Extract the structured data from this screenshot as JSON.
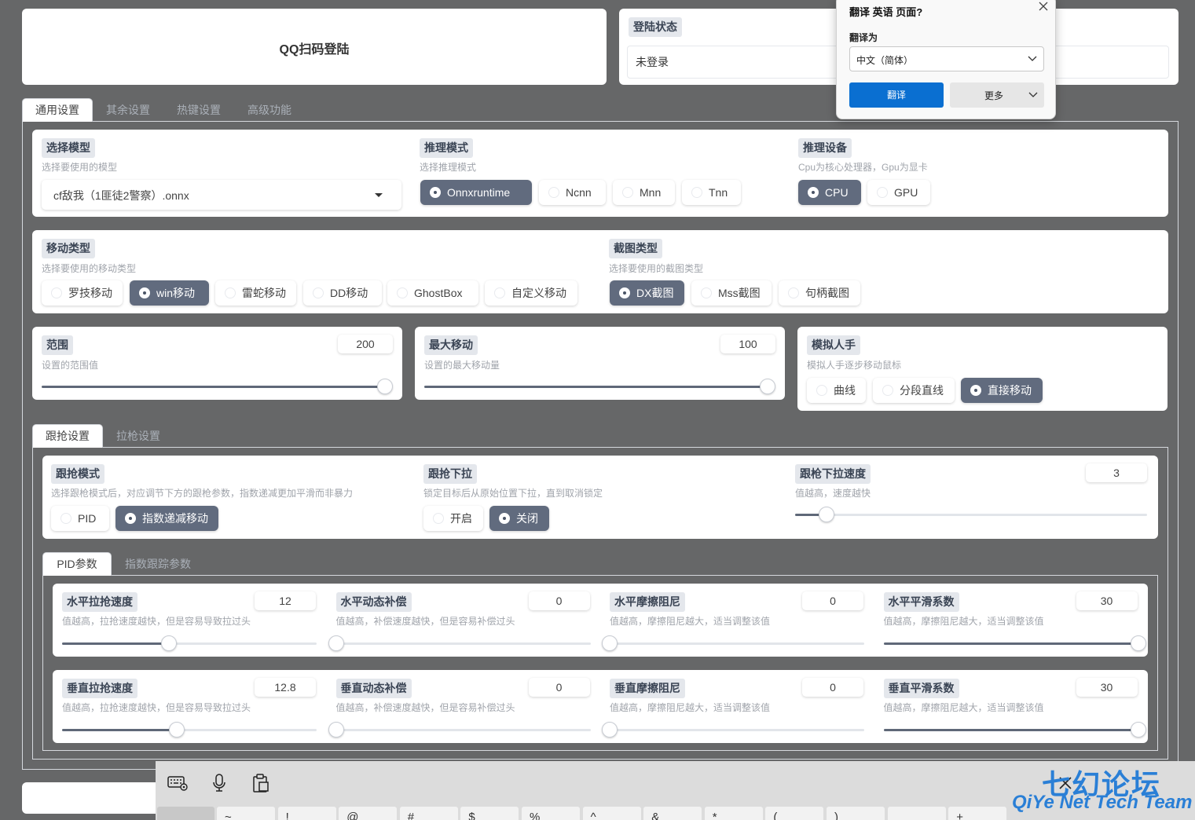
{
  "login": {
    "qr_label": "QQ扫码登陆",
    "status_label": "登陆状态",
    "status_value": "未登录"
  },
  "main_tabs": [
    "通用设置",
    "其余设置",
    "热键设置",
    "高级功能"
  ],
  "model": {
    "label": "选择模型",
    "desc": "选择要使用的模型",
    "value": "cf敌我（1匪徒2警察）.onnx"
  },
  "infer_mode": {
    "label": "推理模式",
    "desc": "选择推理模式",
    "options": [
      "Onnxruntime",
      "Ncnn",
      "Mnn",
      "Tnn"
    ],
    "selected": "Onnxruntime"
  },
  "infer_device": {
    "label": "推理设备",
    "desc": "Cpu为核心处理器，Gpu为显卡",
    "options": [
      "CPU",
      "GPU"
    ],
    "selected": "CPU"
  },
  "move_type": {
    "label": "移动类型",
    "desc": "选择要使用的移动类型",
    "options": [
      "罗技移动",
      "win移动",
      "雷蛇移动",
      "DD移动",
      "GhostBox",
      "自定义移动"
    ],
    "selected": "win移动"
  },
  "capture_type": {
    "label": "截图类型",
    "desc": "选择要使用的截图类型",
    "options": [
      "DX截图",
      "Mss截图",
      "句柄截图"
    ],
    "selected": "DX截图"
  },
  "range": {
    "label": "范围",
    "desc": "设置的范围值",
    "value": "200",
    "fraction": 1.0
  },
  "max_move": {
    "label": "最大移动",
    "desc": "设置的最大移动量",
    "value": "100",
    "fraction": 1.0
  },
  "human": {
    "label": "模拟人手",
    "desc": "模拟人手逐步移动鼠标",
    "options": [
      "曲线",
      "分段直线",
      "直接移动"
    ],
    "selected": "直接移动"
  },
  "sub_tabs": [
    "跟抢设置",
    "拉枪设置"
  ],
  "follow_mode": {
    "label": "跟抢模式",
    "desc": "选择跟枪模式后，对应调节下方的跟枪参数，指数递减更加平滑而非暴力",
    "options": [
      "PID",
      "指数递减移动"
    ],
    "selected": "指数递减移动"
  },
  "follow_pull": {
    "label": "跟抢下拉",
    "desc": "锁定目标后从原始位置下拉，直到取消锁定",
    "options": [
      "开启",
      "关闭"
    ],
    "selected": "关闭"
  },
  "pull_speed": {
    "label": "跟枪下拉速度",
    "desc": "值越高，速度越快",
    "value": "3",
    "fraction": 0.09
  },
  "param_tabs": [
    "PID参数",
    "指数跟踪参数"
  ],
  "pid": {
    "row1": [
      {
        "label": "水平拉抢速度",
        "desc": "值越高，拉抢速度越快，但是容易导致拉过头",
        "value": "12",
        "fraction": 0.42
      },
      {
        "label": "水平动态补偿",
        "desc": "值越高，补偿速度越快，但是容易补偿过头",
        "value": "0",
        "fraction": 0.0
      },
      {
        "label": "水平摩擦阻尼",
        "desc": "值越高，摩擦阻尼越大，适当调整该值",
        "value": "0",
        "fraction": 0.0
      },
      {
        "label": "水平平滑系数",
        "desc": "值越高，摩擦阻尼越大，适当调整该值",
        "value": "30",
        "fraction": 1.0
      }
    ],
    "row2": [
      {
        "label": "垂直拉抢速度",
        "desc": "值越高，拉抢速度越快，但是容易导致拉过头",
        "value": "12.8",
        "fraction": 0.45
      },
      {
        "label": "垂直动态补偿",
        "desc": "值越高，补偿速度越快，但是容易补偿过头",
        "value": "0",
        "fraction": 0.0
      },
      {
        "label": "垂直摩擦阻尼",
        "desc": "值越高，摩擦阻尼越大，适当调整该值",
        "value": "0",
        "fraction": 0.0
      },
      {
        "label": "垂直平滑系数",
        "desc": "值越高，摩擦阻尼越大，适当调整该值",
        "value": "30",
        "fraction": 1.0
      }
    ]
  },
  "translate_popup": {
    "title": "翻译 英语 页面?",
    "to_label": "翻译为",
    "language": "中文（简体）",
    "translate_btn": "翻译",
    "more_btn": "更多"
  },
  "keyboard": {
    "keys": [
      "~",
      "!",
      "@",
      "#",
      "$",
      "%",
      "^",
      "&",
      "*",
      "(",
      ")",
      "_",
      "+"
    ]
  },
  "watermark": {
    "line1": "七幻论坛",
    "line2": "QiYe Net Tech Team"
  },
  "colors": {
    "selected": "#616b7e",
    "background": "#666768",
    "translate_blue": "#0a6fd1",
    "watermark_blue": "#2a7fd6"
  }
}
